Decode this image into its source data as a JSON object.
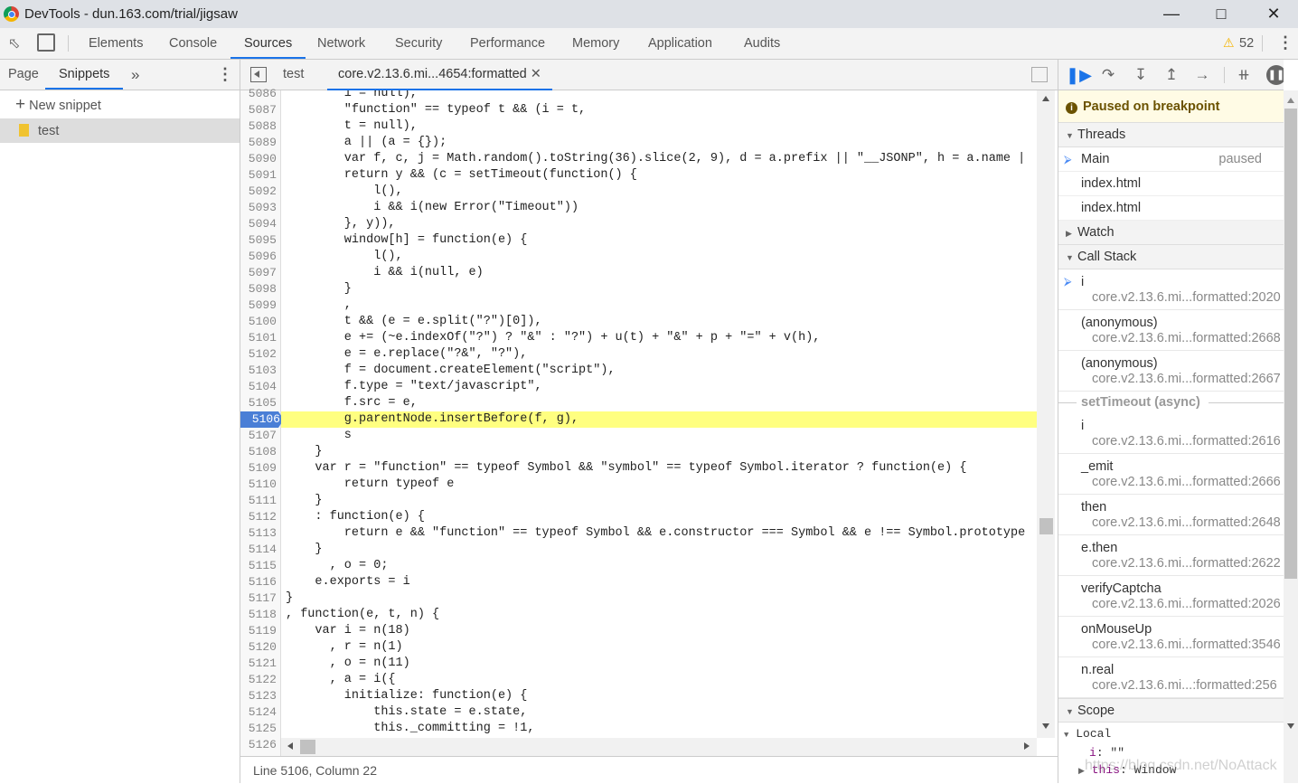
{
  "window": {
    "title": "DevTools - dun.163.com/trial/jigsaw"
  },
  "main_tabs": [
    "Elements",
    "Console",
    "Sources",
    "Network",
    "Security",
    "Performance",
    "Memory",
    "Application",
    "Audits"
  ],
  "active_tab": "Sources",
  "warnings": {
    "count": "52",
    "color": "#f4b400"
  },
  "navigator": {
    "tabs": [
      "Page",
      "Snippets"
    ],
    "active": "Snippets",
    "more": "»",
    "new_snippet": "New snippet",
    "files": [
      {
        "name": "test",
        "selected": true
      }
    ]
  },
  "editor": {
    "tabs": [
      {
        "label": "test"
      },
      {
        "label": "core.v2.13.6.mi...4654:formatted",
        "active": true,
        "closable": true
      }
    ],
    "first_line": 5086,
    "breakpoint_line": 5106,
    "lines": [
      "        i = null),",
      "        \"function\" == typeof t && (i = t,",
      "        t = null),",
      "        a || (a = {});",
      "        var f, c, j = Math.random().toString(36).slice(2, 9), d = a.prefix || \"__JSONP\", h = a.name |",
      "        return y && (c = setTimeout(function() {",
      "            l(),",
      "            i && i(new Error(\"Timeout\"))",
      "        }, y)),",
      "        window[h] = function(e) {",
      "            l(),",
      "            i && i(null, e)",
      "        }",
      "        ,",
      "        t && (e = e.split(\"?\")[0]),",
      "        e += (~e.indexOf(\"?\") ? \"&\" : \"?\") + u(t) + \"&\" + p + \"=\" + v(h),",
      "        e = e.replace(\"?&\", \"?\"),",
      "        f = document.createElement(\"script\"),",
      "        f.type = \"text/javascript\",",
      "        f.src = e,",
      "        g.parentNode.insertBefore(f, g),",
      "        s",
      "    }",
      "    var r = \"function\" == typeof Symbol && \"symbol\" == typeof Symbol.iterator ? function(e) {",
      "        return typeof e",
      "    }",
      "    : function(e) {",
      "        return e && \"function\" == typeof Symbol && e.constructor === Symbol && e !== Symbol.prototype",
      "    }",
      "      , o = 0;",
      "    e.exports = i",
      "}",
      ", function(e, t, n) {",
      "    var i = n(18)",
      "      , r = n(1)",
      "      , o = n(11)",
      "      , a = i({",
      "        initialize: function(e) {",
      "            this.state = e.state,",
      "            this._committing = !1,",
      ""
    ],
    "status": "Line 5106, Column 22"
  },
  "debugger": {
    "paused_message": "Paused on breakpoint",
    "threads_label": "Threads",
    "threads": [
      {
        "name": "Main",
        "state": "paused",
        "current": true
      },
      {
        "name": "index.html"
      },
      {
        "name": "index.html"
      }
    ],
    "watch_label": "Watch",
    "callstack_label": "Call Stack",
    "frames": [
      {
        "fn": "i",
        "loc": "core.v2.13.6.mi...formatted:2020",
        "current": true
      },
      {
        "fn": "(anonymous)",
        "loc": "core.v2.13.6.mi...formatted:2668"
      },
      {
        "fn": "(anonymous)",
        "loc": "core.v2.13.6.mi...formatted:2667"
      },
      {
        "async": "setTimeout (async)"
      },
      {
        "fn": "i",
        "loc": "core.v2.13.6.mi...formatted:2616"
      },
      {
        "fn": "_emit",
        "loc": "core.v2.13.6.mi...formatted:2666"
      },
      {
        "fn": "then",
        "loc": "core.v2.13.6.mi...formatted:2648"
      },
      {
        "fn": "e.then",
        "loc": "core.v2.13.6.mi...formatted:2622"
      },
      {
        "fn": "verifyCaptcha",
        "loc": "core.v2.13.6.mi...formatted:2026"
      },
      {
        "fn": "onMouseUp",
        "loc": "core.v2.13.6.mi...formatted:3546"
      },
      {
        "fn": "n.real",
        "loc": "core.v2.13.6.mi...:formatted:256"
      }
    ],
    "scope_label": "Scope",
    "local_label": "Local",
    "scope_vars": [
      {
        "name": "i",
        "value": "\"\""
      },
      {
        "name": "this",
        "value": "Window"
      }
    ],
    "watermark": "https://blog.csdn.net/NoAttack"
  }
}
